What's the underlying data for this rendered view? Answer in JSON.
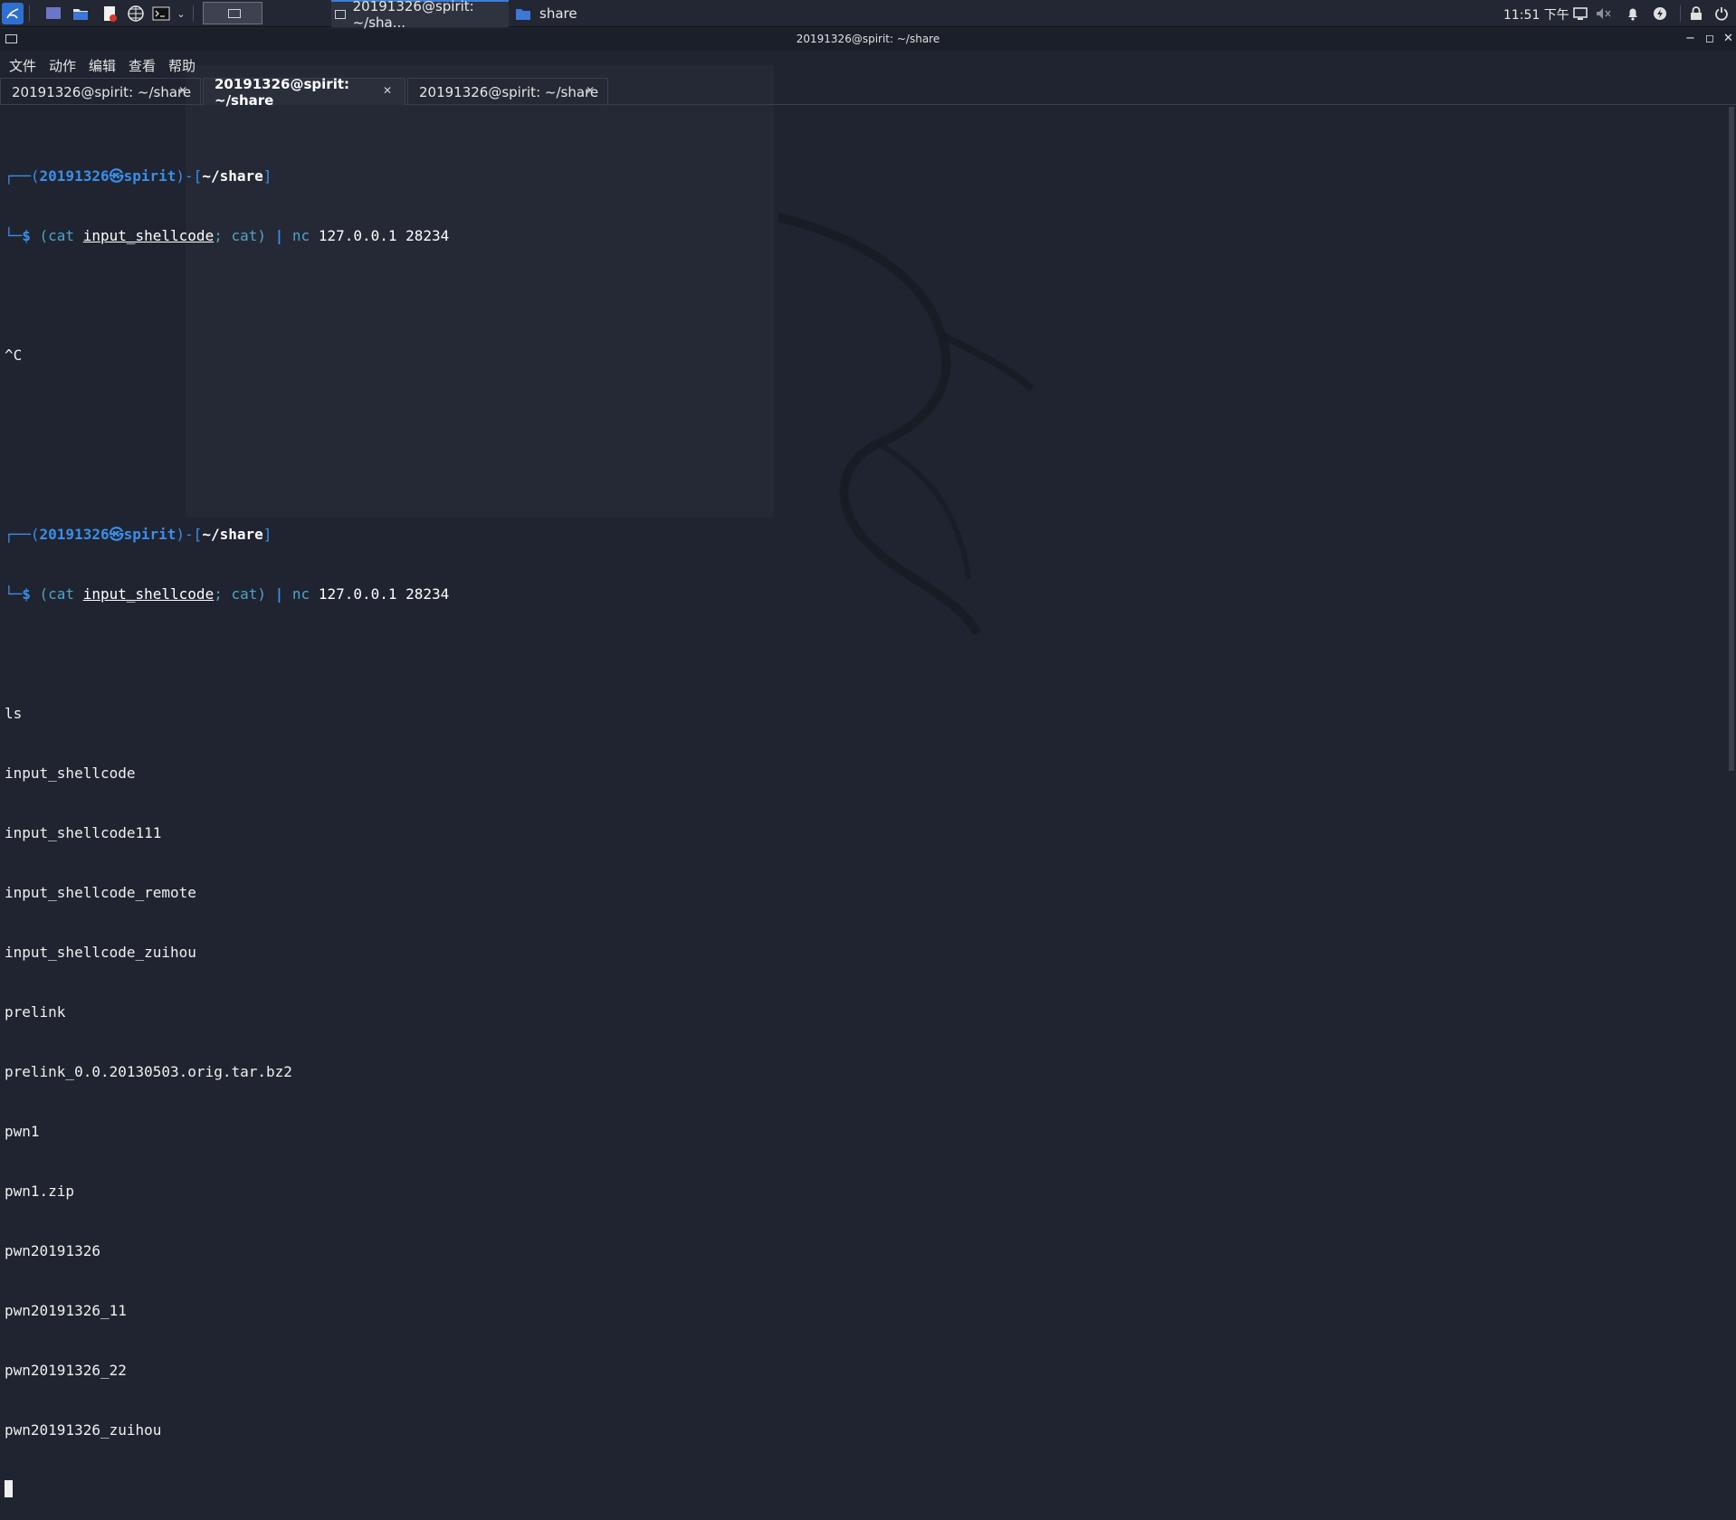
{
  "panel": {
    "task1_label": "20191326@spirit: ~/sha...",
    "task2_label": "share",
    "clock": "11:51 下午"
  },
  "window": {
    "title": "20191326@spirit: ~/share"
  },
  "menu": [
    "文件",
    "动作",
    "编辑",
    "查看",
    "帮助"
  ],
  "tabs": [
    {
      "label": "20191326@spirit: ~/share",
      "active": false
    },
    {
      "label": "20191326@spirit: ~/share",
      "active": true
    },
    {
      "label": "20191326@spirit: ~/share",
      "active": false
    }
  ],
  "prompt": {
    "frame_top": "┌──(",
    "user_host": "20191326㉿spirit",
    "mid": ")-[",
    "path": "~/share",
    "close": "]",
    "frame_bottom": "└─",
    "dollar": "$ ",
    "open_paren": "(cat ",
    "file": "input_shellcode",
    "semi": ";",
    "cat2": " cat) ",
    "pipe": "|",
    "nc": " nc",
    "args": " 127.0.0.1 28234"
  },
  "interrupt": "^C",
  "ls_command": "ls",
  "ls_output": [
    "input_shellcode",
    "input_shellcode111",
    "input_shellcode_remote",
    "input_shellcode_zuihou",
    "prelink",
    "prelink_0.0.20130503.orig.tar.bz2",
    "pwn1",
    "pwn1.zip",
    "pwn20191326",
    "pwn20191326_11",
    "pwn20191326_22",
    "pwn20191326_zuihou"
  ],
  "colors": {
    "prompt_blue": "#3b8eea",
    "background": "#1f2430"
  }
}
